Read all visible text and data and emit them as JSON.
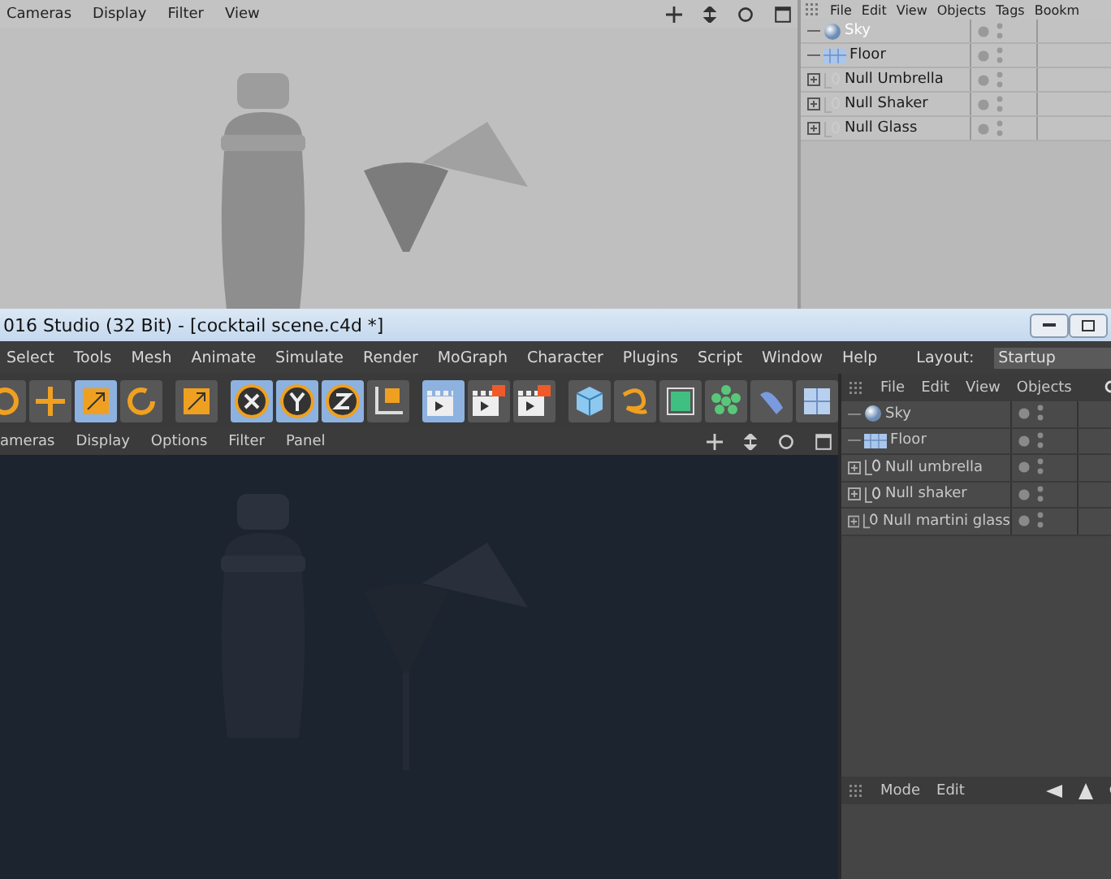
{
  "top_view": {
    "menu": [
      "Cameras",
      "Display",
      "Filter",
      "View"
    ]
  },
  "top_objects": {
    "menu": [
      "File",
      "Edit",
      "View",
      "Objects",
      "Tags",
      "Bookm"
    ],
    "items": [
      {
        "name": "Sky",
        "kind": "sky",
        "selected": true,
        "expandable": false
      },
      {
        "name": "Floor",
        "kind": "floor",
        "selected": false,
        "expandable": false
      },
      {
        "name": "Null Umbrella",
        "kind": "null",
        "selected": false,
        "expandable": true
      },
      {
        "name": "Null Shaker",
        "kind": "null",
        "selected": false,
        "expandable": true
      },
      {
        "name": "Null Glass",
        "kind": "null",
        "selected": false,
        "expandable": true
      }
    ]
  },
  "title_bar": {
    "title": "016 Studio (32 Bit) - [cocktail scene.c4d *]"
  },
  "menu_bar": {
    "items": [
      "Select",
      "Tools",
      "Mesh",
      "Animate",
      "Simulate",
      "Render",
      "MoGraph",
      "Character",
      "Plugins",
      "Script",
      "Window",
      "Help"
    ],
    "layout_label": "Layout:",
    "layout_value": "Startup"
  },
  "toolbar": [
    {
      "kind": "live",
      "selected": false
    },
    {
      "kind": "move",
      "selected": false
    },
    {
      "kind": "scale",
      "selected": true
    },
    {
      "kind": "rotate",
      "selected": false
    },
    {
      "kind": "last",
      "selected": false
    },
    {
      "kind": "x",
      "selected": true
    },
    {
      "kind": "y",
      "selected": true
    },
    {
      "kind": "z",
      "selected": true
    },
    {
      "kind": "coords",
      "selected": false
    },
    {
      "kind": "render-view",
      "selected": true
    },
    {
      "kind": "render-picture",
      "selected": false
    },
    {
      "kind": "render-settings",
      "selected": false
    },
    {
      "kind": "cube",
      "selected": false
    },
    {
      "kind": "spline",
      "selected": false
    },
    {
      "kind": "nurbs",
      "selected": false
    },
    {
      "kind": "array",
      "selected": false
    },
    {
      "kind": "deformer",
      "selected": false
    },
    {
      "kind": "floor",
      "selected": false
    }
  ],
  "bottom_view": {
    "menu": [
      "ameras",
      "Display",
      "Options",
      "Filter",
      "Panel"
    ]
  },
  "objects": {
    "menu": [
      "File",
      "Edit",
      "View",
      "Objects"
    ],
    "items": [
      {
        "name": "Sky",
        "kind": "sky",
        "selected": false,
        "expandable": false
      },
      {
        "name": "Floor",
        "kind": "floor",
        "selected": false,
        "expandable": false
      },
      {
        "name": "Null umbrella",
        "kind": "null",
        "selected": false,
        "expandable": true
      },
      {
        "name": "Null shaker",
        "kind": "null",
        "selected": false,
        "expandable": true
      },
      {
        "name": "Null martini glass",
        "kind": "null",
        "selected": false,
        "expandable": true
      }
    ]
  },
  "attributes": {
    "menu": [
      "Mode",
      "Edit"
    ]
  }
}
